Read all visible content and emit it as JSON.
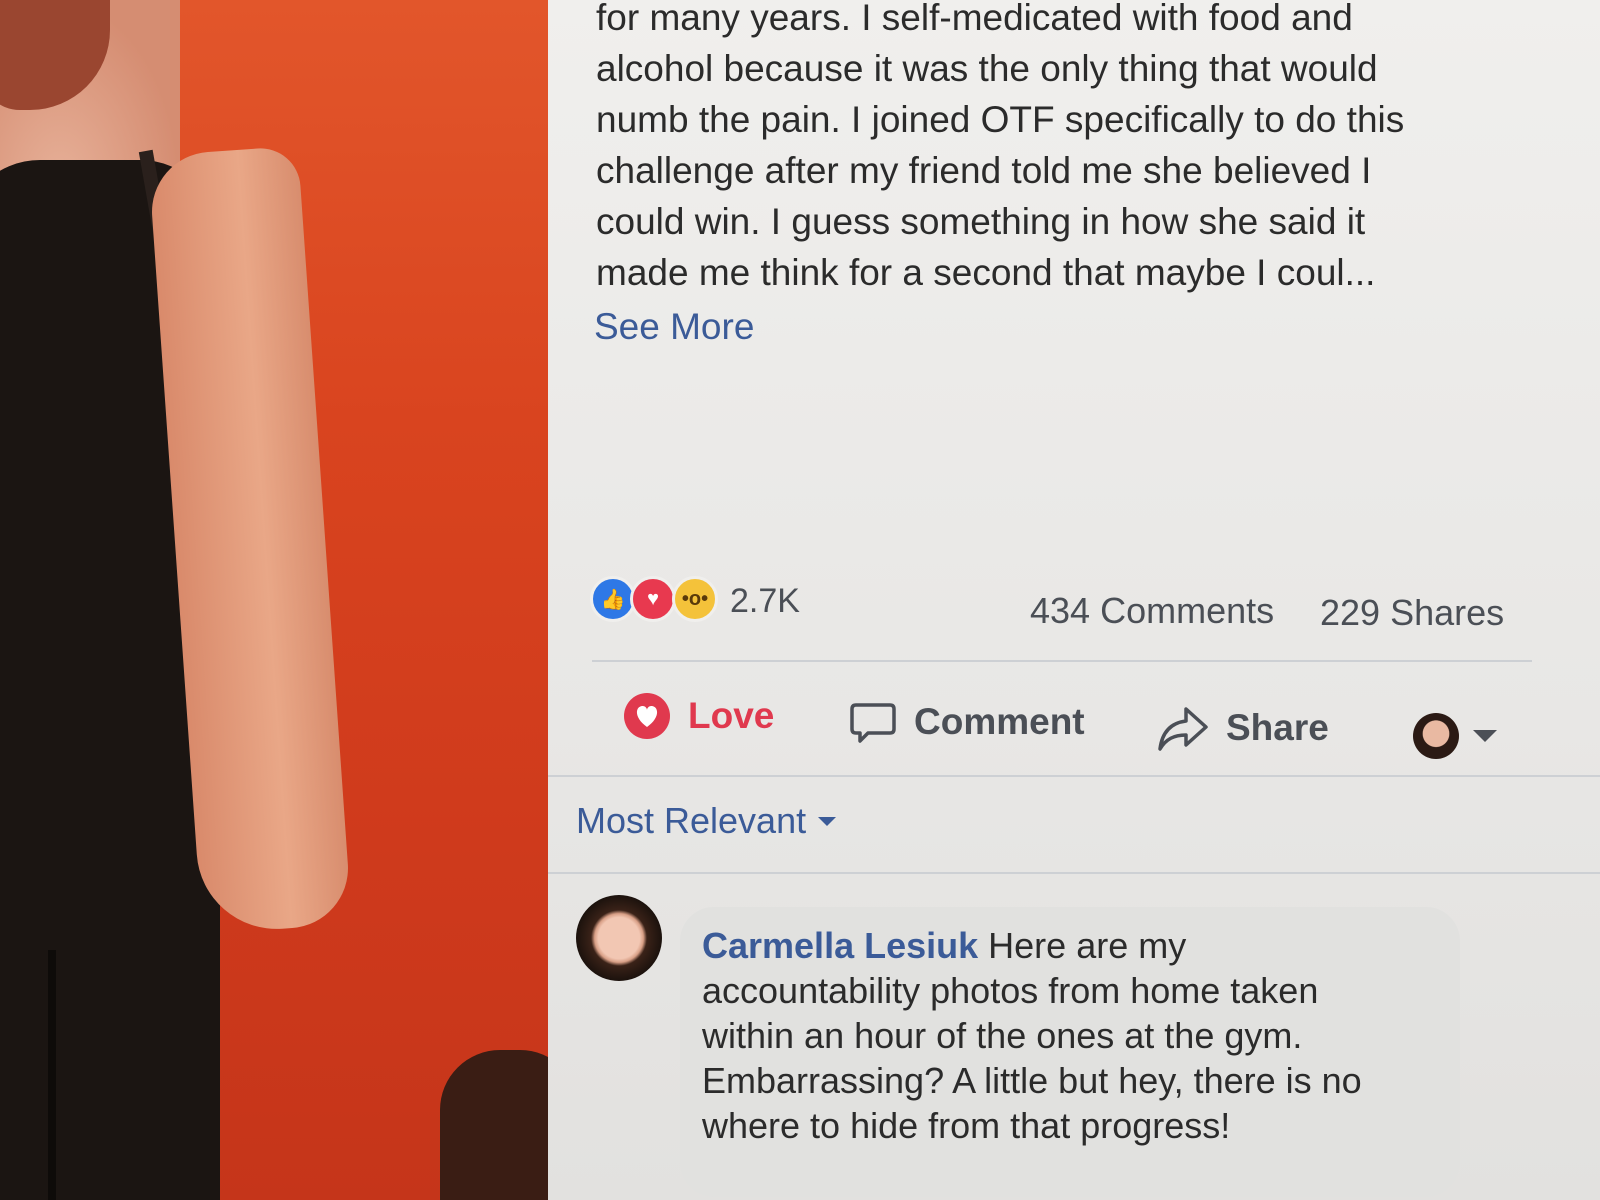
{
  "post": {
    "text_lines": [
      "for many years. I self-medicated with food and",
      "alcohol because it was the only thing that would",
      "numb the pain. I joined OTF specifically to do this",
      "challenge after my friend told me she believed I",
      "could win. I guess something in how she said it",
      "made me think for a second that maybe I coul..."
    ],
    "see_more": "See More"
  },
  "stats": {
    "reaction_icons": [
      "like-icon",
      "love-icon",
      "wow-icon"
    ],
    "reaction_count": "2.7K",
    "comments": "434 Comments",
    "shares": "229 Shares"
  },
  "actions": {
    "love": "Love",
    "comment": "Comment",
    "share": "Share"
  },
  "colors": {
    "link_blue": "#3b5b98",
    "love_red": "#e0394e",
    "like_blue": "#2e78e6",
    "wow_yellow": "#f4c23a"
  },
  "comments_section": {
    "sort_label": "Most Relevant",
    "items": [
      {
        "author": "Carmella Lesiuk",
        "first_line": "Here are my",
        "lines": [
          "accountability photos from home taken",
          "within an hour of the ones at the gym.",
          "Embarrassing? A little but hey, there is no",
          "where to hide from that progress!"
        ]
      }
    ]
  }
}
